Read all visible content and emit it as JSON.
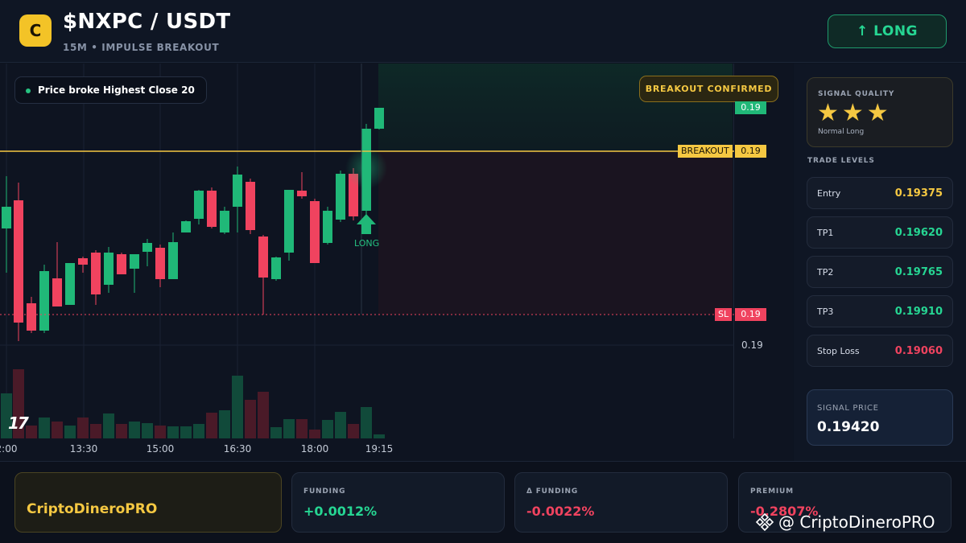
{
  "header": {
    "logo_letter": "C",
    "pair": "$NXPC / USDT",
    "subtitle": "15M • IMPULSE BREAKOUT",
    "direction_button": "↑ LONG"
  },
  "chart": {
    "note": "Price broke Highest Close 20",
    "confirm_badge": "BREAKOUT CONFIRMED",
    "current_price_tag": "0.19",
    "breakout_label": "BREAKOUT",
    "breakout_price_tag": "0.19",
    "sl_label": "SL",
    "sl_price_tag": "0.19",
    "axis_price": "0.19",
    "signal_label": "LONG",
    "tv_logo": "17",
    "time_ticks": [
      "2:00",
      "13:30",
      "15:00",
      "16:30",
      "18:00",
      "19:15"
    ],
    "colors": {
      "up": "#20b878",
      "down": "#f0435f",
      "breakout": "#f5c842"
    }
  },
  "panel": {
    "quality_title": "SIGNAL QUALITY",
    "stars": "★★★",
    "quality_sub": "Normal Long",
    "levels_title": "TRADE LEVELS",
    "levels": [
      {
        "label": "Entry",
        "value": "0.19375",
        "color": "#f5c842"
      },
      {
        "label": "TP1",
        "value": "0.19620",
        "color": "#26d693"
      },
      {
        "label": "TP2",
        "value": "0.19765",
        "color": "#26d693"
      },
      {
        "label": "TP3",
        "value": "0.19910",
        "color": "#26d693"
      },
      {
        "label": "Stop Loss",
        "value": "0.19060",
        "color": "#f0435f"
      }
    ],
    "signal_price_label": "SIGNAL PRICE",
    "signal_price": "0.19420"
  },
  "footer": {
    "brand": "CriptoDineroPRO",
    "stats": [
      {
        "label": "FUNDING",
        "value": "+0.0012%",
        "color": "#26d693"
      },
      {
        "label": "Δ FUNDING",
        "value": "-0.0022%",
        "color": "#f0435f"
      },
      {
        "label": "PREMIUM",
        "value": "-0.2807%",
        "color": "#f0435f"
      }
    ],
    "watermark": "@ CriptoDineroPRO"
  }
}
